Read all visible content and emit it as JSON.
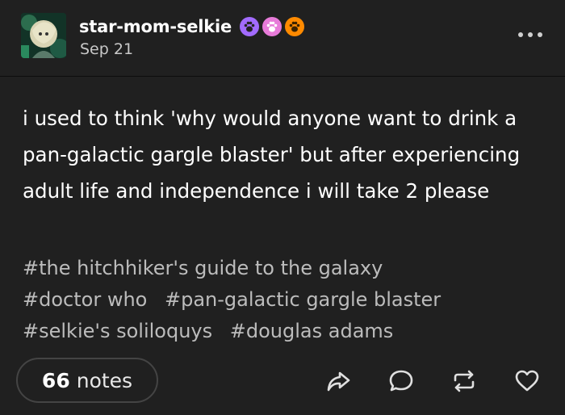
{
  "post": {
    "username": "star-mom-selkie",
    "date": "Sep 21",
    "body": "i used to think 'why would anyone want to drink a pan-galactic gargle blaster' but after experiencing adult life and independence i will take 2 please",
    "tags": [
      "#the hitchhiker's guide to the galaxy",
      "#doctor who",
      "#pan-galactic gargle blaster",
      "#selkie's soliloquys",
      "#douglas adams"
    ],
    "notes_count": "66",
    "notes_label": "notes"
  },
  "colors": {
    "background": "#202020",
    "badge_purple": "#a26bff",
    "badge_pink": "#e77bd9",
    "badge_orange": "#ff8a00"
  }
}
